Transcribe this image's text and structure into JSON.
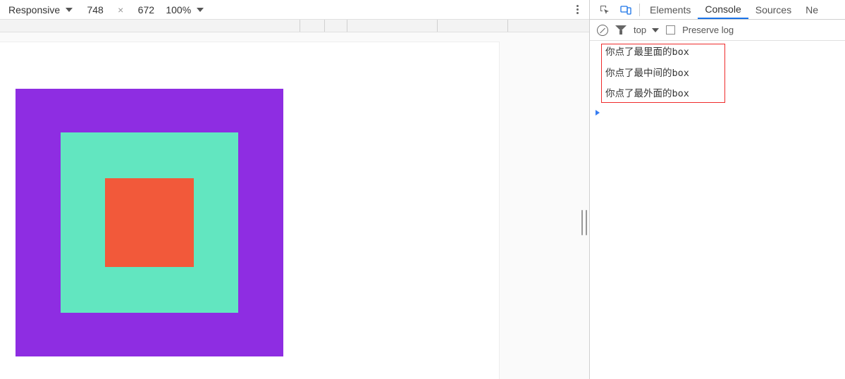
{
  "device_toolbar": {
    "mode_label": "Responsive",
    "width": "748",
    "height": "672",
    "zoom": "100%"
  },
  "devtools": {
    "tabs": {
      "elements": "Elements",
      "console": "Console",
      "sources": "Sources",
      "next_partial": "Ne"
    },
    "active_tab": "console"
  },
  "console_toolbar": {
    "context": "top",
    "preserve_log_label": "Preserve log"
  },
  "console": {
    "messages": [
      "你点了最里面的box",
      "你点了最中间的box",
      "你点了最外面的box"
    ]
  },
  "boxes": {
    "outer_color": "#8e2de2",
    "middle_color": "#62e6c0",
    "inner_color": "#f2593a"
  }
}
